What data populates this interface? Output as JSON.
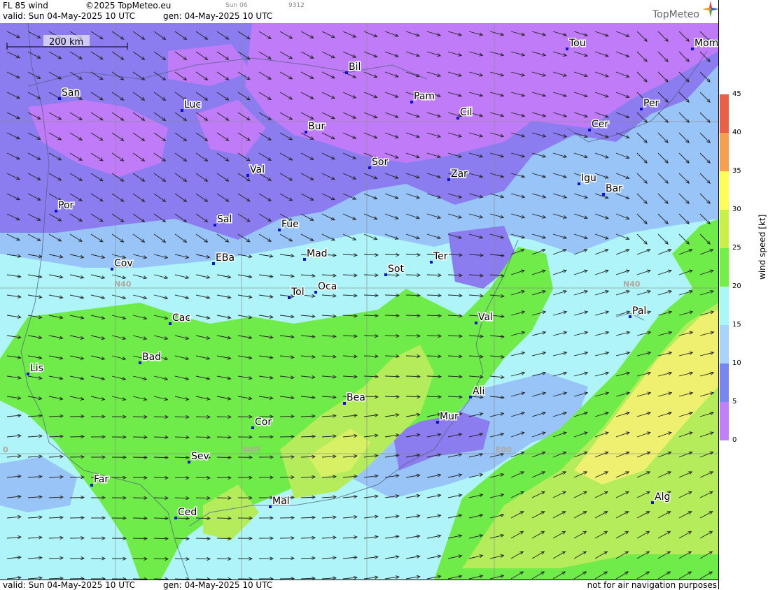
{
  "header": {
    "title": "FL 85 wind",
    "copyright": "©2025 TopMeteo.eu",
    "valid": "valid:  Sun  04-May-2025  10 UTC",
    "gen": "gen: 04-May-2025 10 UTC",
    "small1": "Sun 06",
    "small2": "9312",
    "logo": "TopMeteo"
  },
  "footer": {
    "valid": "valid:  Sun  04-May-2025  10 UTC",
    "gen": "gen: 04-May-2025 10 UTC",
    "note": "not for air navigation purposes"
  },
  "scale_bar": "200 km",
  "grid_labels": [
    "N40",
    "N40",
    "W05",
    "E00",
    "0"
  ],
  "cities": [
    {
      "name": "San"
    },
    {
      "name": "Luc"
    },
    {
      "name": "Bil"
    },
    {
      "name": "Pam"
    },
    {
      "name": "Tou"
    },
    {
      "name": "Mom"
    },
    {
      "name": "Per"
    },
    {
      "name": "Cer"
    },
    {
      "name": "Cil"
    },
    {
      "name": "Bur"
    },
    {
      "name": "Sor"
    },
    {
      "name": "Zar"
    },
    {
      "name": "Igu"
    },
    {
      "name": "Bar"
    },
    {
      "name": "Val"
    },
    {
      "name": "Por"
    },
    {
      "name": "Sal"
    },
    {
      "name": "Fue"
    },
    {
      "name": "Mad"
    },
    {
      "name": "Cov"
    },
    {
      "name": "EBa"
    },
    {
      "name": "Ter"
    },
    {
      "name": "Sot"
    },
    {
      "name": "Tol"
    },
    {
      "name": "Oca"
    },
    {
      "name": "Pal"
    },
    {
      "name": "Cac"
    },
    {
      "name": "Val"
    },
    {
      "name": "Lis"
    },
    {
      "name": "Bad"
    },
    {
      "name": "Ali"
    },
    {
      "name": "Bea"
    },
    {
      "name": "Mur"
    },
    {
      "name": "Cor"
    },
    {
      "name": "Sev"
    },
    {
      "name": "Far"
    },
    {
      "name": "Mal"
    },
    {
      "name": "Ced"
    },
    {
      "name": "Alg"
    }
  ],
  "legend": {
    "unit_label": "wind speed [kt]",
    "ticks": [
      "45",
      "40",
      "35",
      "30",
      "25",
      "20",
      "15",
      "10",
      "5",
      "0"
    ],
    "colors": [
      "#e86048",
      "#f4a050",
      "#ffff58",
      "#c8f048",
      "#72f048",
      "#a8f8f8",
      "#a8d4fc",
      "#7a86f0",
      "#c080f8"
    ]
  },
  "colors": {
    "purple": "#c07cf8",
    "blue_purple": "#8b7cf0",
    "light_blue": "#98c4f8",
    "cyan": "#aef4f8",
    "green": "#70ec4a",
    "light_green": "#b4ec5c",
    "yellow": "#f0f070"
  }
}
